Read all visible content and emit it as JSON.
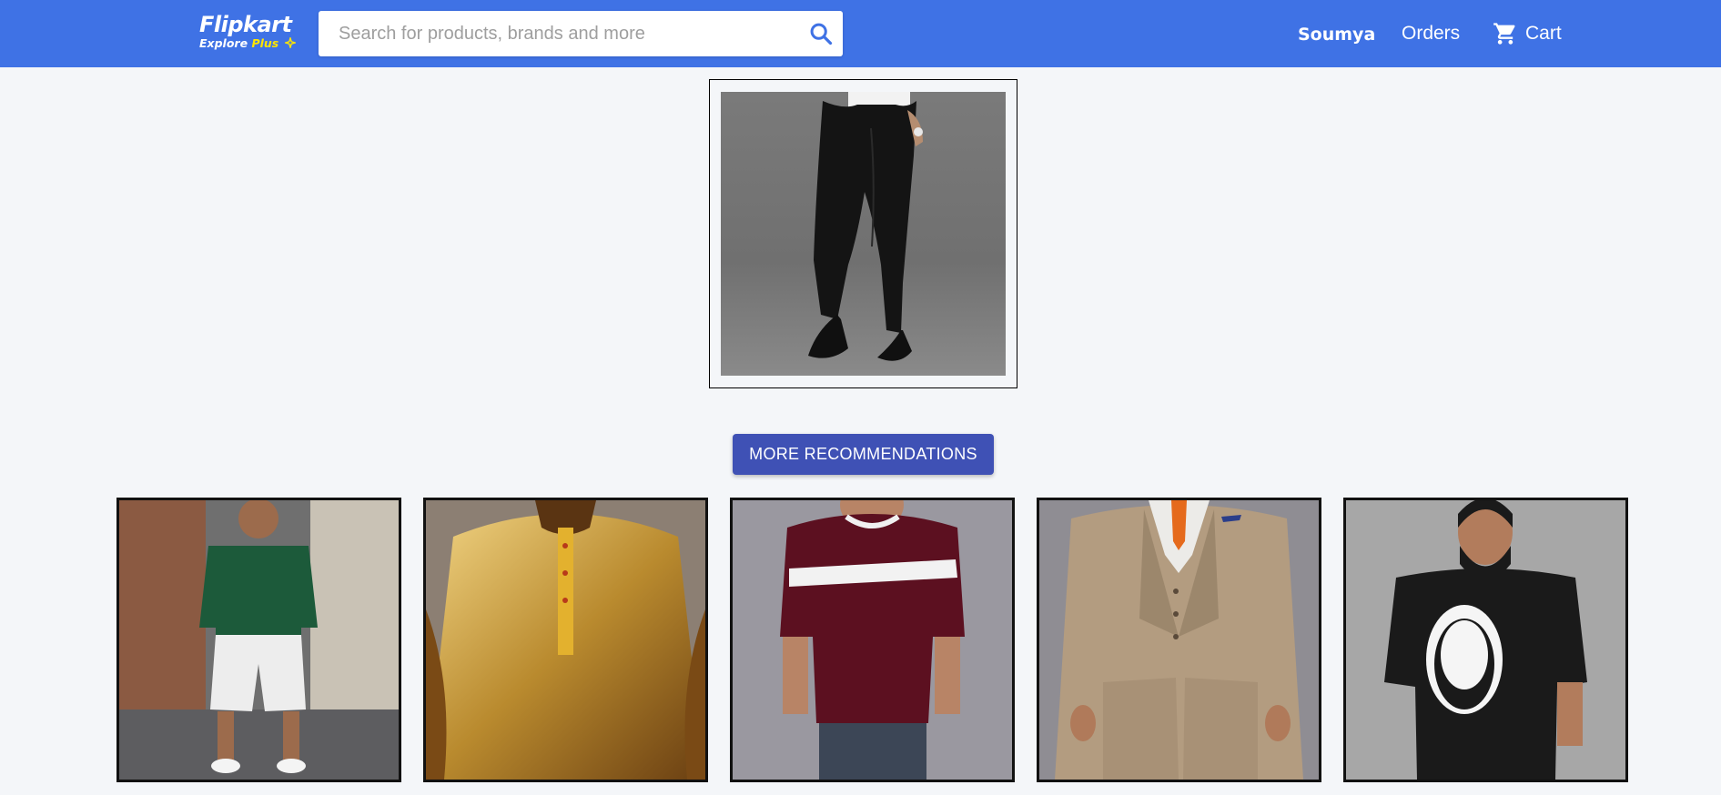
{
  "header": {
    "brand": "Flipkart",
    "brand_sub_prefix": "Explore",
    "brand_sub_plus": "Plus",
    "search_placeholder": "Search for products, brands and more",
    "user_name": "Soumya",
    "orders_label": "Orders",
    "cart_label": "Cart",
    "colors": {
      "bar": "#3f72e5",
      "plus_accent": "#ffe500"
    },
    "icons": [
      "search-icon",
      "cart-icon",
      "plus-star-icon"
    ]
  },
  "product": {
    "image": "black-trousers-photo"
  },
  "more_button": {
    "label": "MORE RECOMMENDATIONS",
    "color": "#3f51b5"
  },
  "recommendations": [
    {
      "image": "green-tshirt-white-shorts-photo"
    },
    {
      "image": "golden-kurta-photo"
    },
    {
      "image": "maroon-striped-tshirt-photo"
    },
    {
      "image": "beige-three-piece-suit-photo"
    },
    {
      "image": "black-graphic-tshirt-photo"
    }
  ]
}
